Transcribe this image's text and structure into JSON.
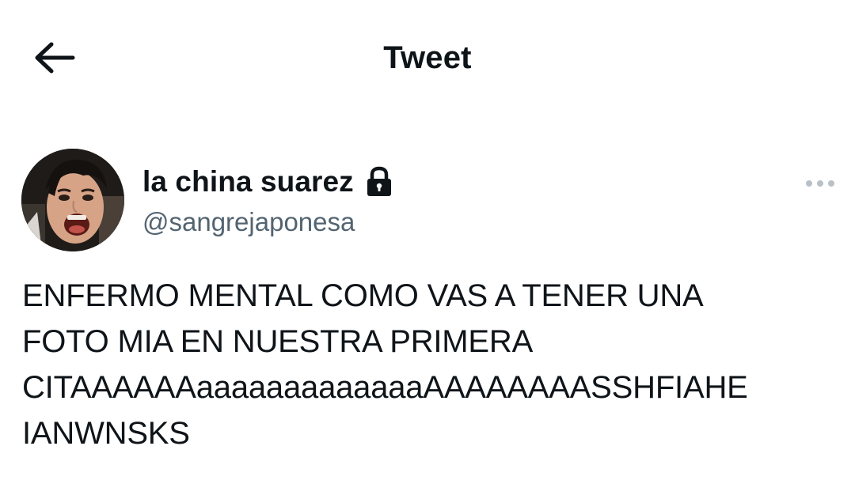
{
  "header": {
    "title": "Tweet",
    "back_icon": "arrow-left-icon"
  },
  "tweet": {
    "display_name": "la china suarez",
    "protected_icon": "lock-icon",
    "handle": "@sangrejaponesa",
    "more_icon": "more-horizontal-icon",
    "text": "ENFERMO MENTAL COMO VAS A TENER UNA\nFOTO MIA EN NUESTRA PRIMERA\nCITAAAAAAaaaaaaaaaaaaaAAAAAAAASSHFIAHE\nIANWNSKS"
  },
  "colors": {
    "text_primary": "#0f1419",
    "text_secondary": "#536471",
    "background": "#ffffff",
    "icon_muted": "#b9c1c8"
  }
}
